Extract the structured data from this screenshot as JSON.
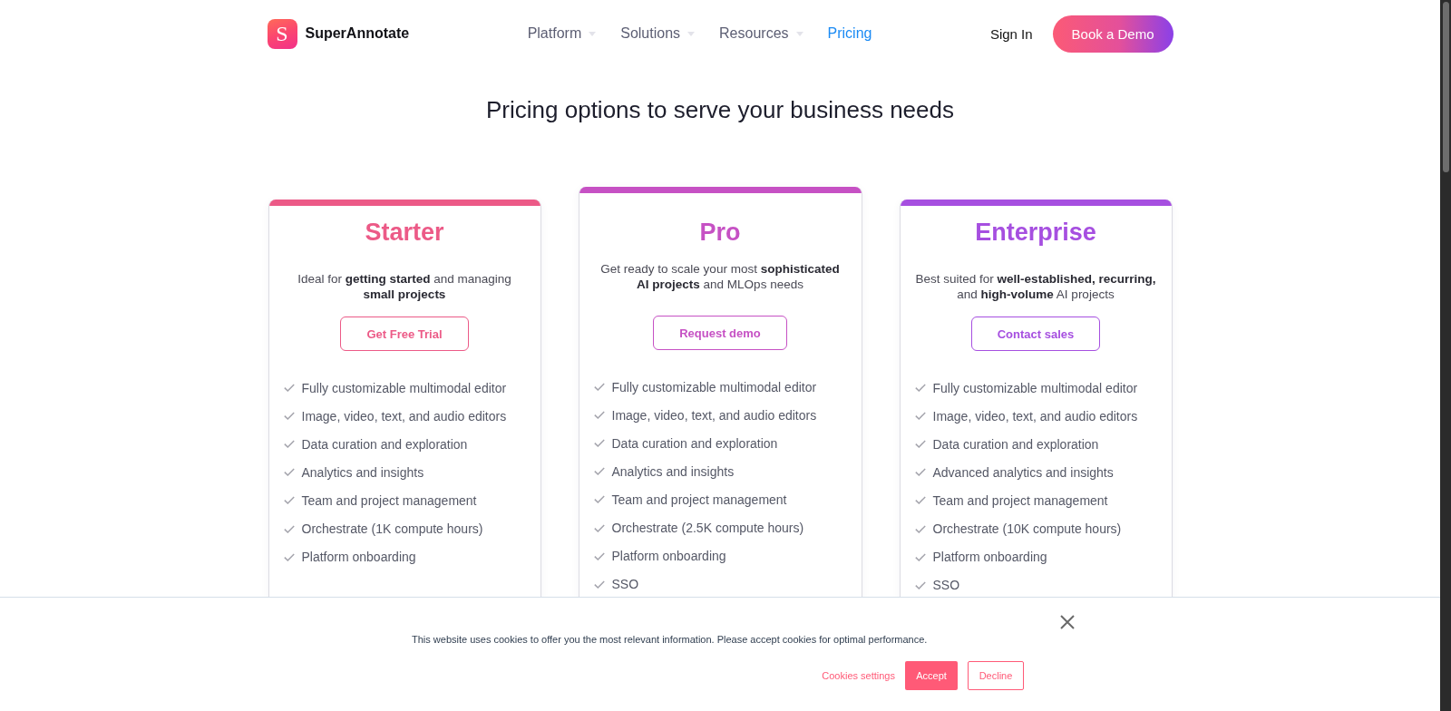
{
  "header": {
    "logo": {
      "mark": "S",
      "name": "SuperAnnotate"
    },
    "nav": [
      {
        "label": "Platform",
        "dropdown": true,
        "selected": false
      },
      {
        "label": "Solutions",
        "dropdown": true,
        "selected": false
      },
      {
        "label": "Resources",
        "dropdown": true,
        "selected": false
      },
      {
        "label": "Pricing",
        "dropdown": false,
        "selected": true
      }
    ],
    "sign_in": "Sign In",
    "cta": "Book a Demo"
  },
  "heading": "Pricing options to serve your business needs",
  "tiers": [
    {
      "name": "Starter",
      "color": "#ec5a87",
      "featured": false,
      "description": "Ideal for **getting started** and managing\n**small projects**",
      "button": "Get Free Trial",
      "features": [
        "Fully customizable multimodal editor",
        "Image, video, text, and audio editors",
        "Data curation and exploration",
        "Analytics and insights",
        "Team and project management",
        "Orchestrate (1K compute hours)",
        "Platform onboarding"
      ]
    },
    {
      "name": "Pro",
      "color": "#c651c4",
      "featured": true,
      "description": "Get ready to scale your most **sophisticated**\n**AI projects** and MLOps needs",
      "button": "Request demo",
      "features": [
        "Fully customizable multimodal editor",
        "Image, video, text, and audio editors",
        "Data curation and exploration",
        "Analytics and insights",
        "Team and project management",
        "Orchestrate (2.5K compute hours)",
        "Platform onboarding",
        "SSO"
      ]
    },
    {
      "name": "Enterprise",
      "color": "#a64fe0",
      "featured": false,
      "description": "Best suited for **well-established, recurring,**\nand **high-volume** AI projects",
      "button": "Contact sales",
      "features": [
        "Fully customizable multimodal editor",
        "Image, video, text, and audio editors",
        "Data curation and exploration",
        "Advanced analytics and insights",
        "Team and project management",
        "Orchestrate (10K compute hours)",
        "Platform onboarding",
        "SSO"
      ]
    }
  ],
  "cookie_banner": {
    "message": "This website uses cookies to offer you the most relevant information. Please accept cookies for optimal performance.",
    "settings_link": "Cookies settings",
    "accept": "Accept",
    "decline": "Decline"
  }
}
